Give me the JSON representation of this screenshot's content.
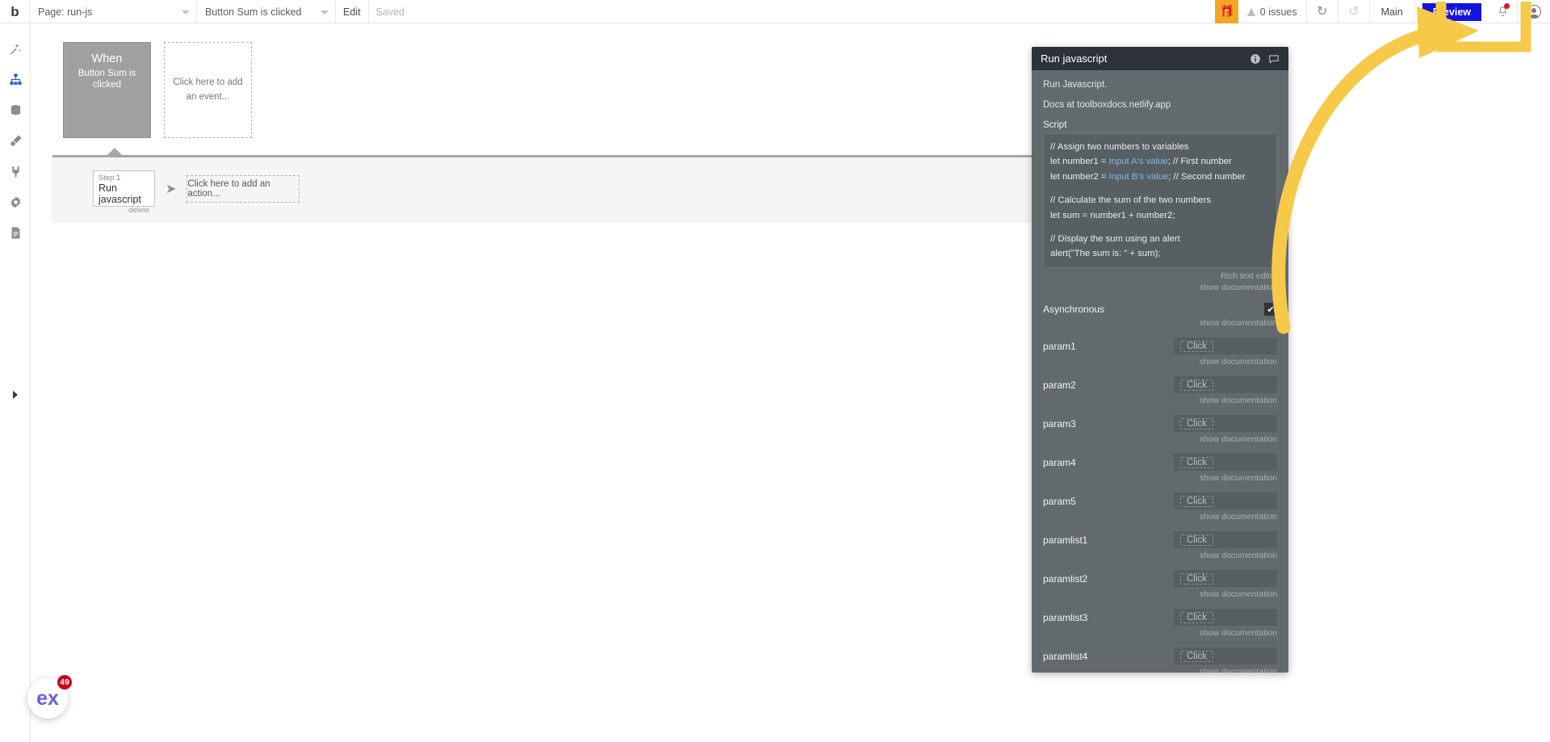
{
  "topbar": {
    "logo": "b",
    "page_select": {
      "value": "Page: run-js",
      "caret_icon": "chevron-down-icon"
    },
    "event_select": {
      "value": "Button Sum is clicked",
      "caret_icon": "chevron-down-icon"
    },
    "edit_label": "Edit",
    "saved_label": "Saved",
    "gift_icon": "gift-icon",
    "gift_bg": "#f5a623",
    "issues_label": "0 issues",
    "undo_icon": "undo-icon",
    "redo_icon": "redo-icon",
    "branch_label": "Main",
    "preview_label": "Preview",
    "preview_bg": "#1414e0",
    "notification_icon": "bell-icon",
    "notification_dot_color": "#e81123",
    "avatar_icon": "user-avatar-icon"
  },
  "sidebar": {
    "items": [
      {
        "icon": "design-wand-icon",
        "active": false
      },
      {
        "icon": "workflow-sitemap-icon",
        "active": true
      },
      {
        "icon": "database-icon",
        "active": false
      },
      {
        "icon": "styles-brush-icon",
        "active": false
      },
      {
        "icon": "plugins-plug-icon",
        "active": false
      },
      {
        "icon": "settings-gear-icon",
        "active": false
      },
      {
        "icon": "logs-document-icon",
        "active": false
      }
    ],
    "active_color": "#2f57c9",
    "inactive_color": "#8d8d8d",
    "expand_icon": "expand-right-arrow-icon"
  },
  "canvas": {
    "when_card": {
      "title": "When",
      "subtitle": "Button Sum is clicked"
    },
    "add_event_card": {
      "text": "Click here to add an event..."
    },
    "step_strip": {
      "step": {
        "index_label": "Step 1",
        "title": "Run javascript",
        "delete_label": "delete"
      },
      "arrow_icon": "arrow-right-icon",
      "add_action_card": {
        "text": "Click here to add an action..."
      },
      "close_icon": "close-icon"
    }
  },
  "panel": {
    "title": "Run javascript",
    "info_icon": "info-icon",
    "comment_icon": "comment-bubble-icon",
    "description_line1": "Run Javascript.",
    "description_line2": "Docs at toolboxdocs.netlify.app",
    "script_label": "Script",
    "script_lines": [
      {
        "type": "text",
        "text": "// Assign two numbers to variables"
      },
      {
        "type": "mixed",
        "pre": "let number1 = ",
        "dyn": "Input A's value",
        "post": "; // First number"
      },
      {
        "type": "mixed",
        "pre": "let number2 = ",
        "dyn": "Input B's value",
        "post": "; // Second number"
      },
      {
        "type": "blank"
      },
      {
        "type": "text",
        "text": "// Calculate the sum of the two numbers"
      },
      {
        "type": "text",
        "text": "let sum = number1 + number2;"
      },
      {
        "type": "blank"
      },
      {
        "type": "text",
        "text": "// Display the sum using an alert"
      },
      {
        "type": "text",
        "text": "alert(\"The sum is: \" + sum);"
      }
    ],
    "rich_text_editor_label": "Rich text editor",
    "show_documentation_label": "show documentation",
    "async_row": {
      "label": "Asynchronous",
      "checked": true,
      "check_icon": "checkmark-icon"
    },
    "param_rows": [
      {
        "label": "param1",
        "value_placeholder": "Click"
      },
      {
        "label": "param2",
        "value_placeholder": "Click"
      },
      {
        "label": "param3",
        "value_placeholder": "Click"
      },
      {
        "label": "param4",
        "value_placeholder": "Click"
      },
      {
        "label": "param5",
        "value_placeholder": "Click"
      },
      {
        "label": "paramlist1",
        "value_placeholder": "Click"
      },
      {
        "label": "paramlist2",
        "value_placeholder": "Click"
      },
      {
        "label": "paramlist3",
        "value_placeholder": "Click"
      },
      {
        "label": "paramlist4",
        "value_placeholder": "Click"
      }
    ]
  },
  "annotations": {
    "arrow_color": "#f7c948",
    "highlight_box_color": "#f7c948",
    "arrow_name": "pointer-arrow-to-preview",
    "highlight_name": "preview-button-highlight"
  },
  "chat_widget": {
    "logo_text": "ex",
    "badge_count": "49",
    "badge_color": "#d0021b"
  }
}
